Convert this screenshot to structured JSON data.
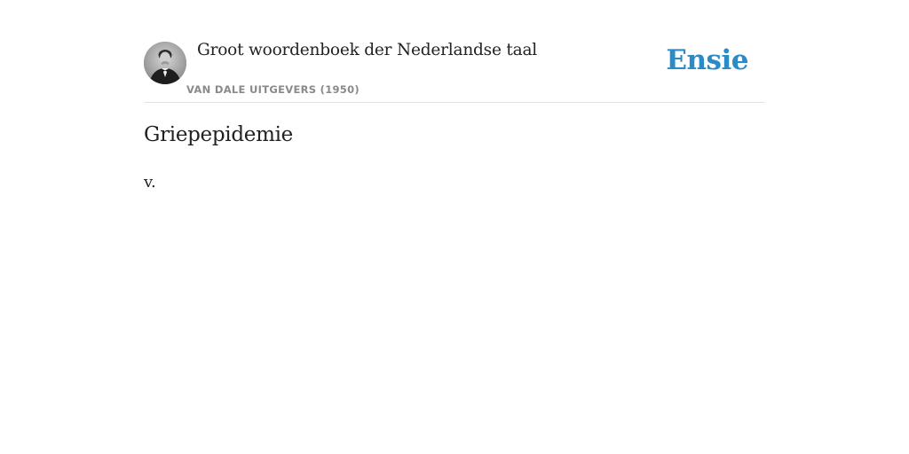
{
  "header": {
    "book_title": "Groot woordenboek der Nederlandse taal",
    "publisher": "VAN DALE UITGEVERS (1950)",
    "logo_text": "Ensie",
    "logo_color": "#2b8bc6"
  },
  "entry": {
    "headword": "Griepepidemie",
    "definition": "v."
  }
}
